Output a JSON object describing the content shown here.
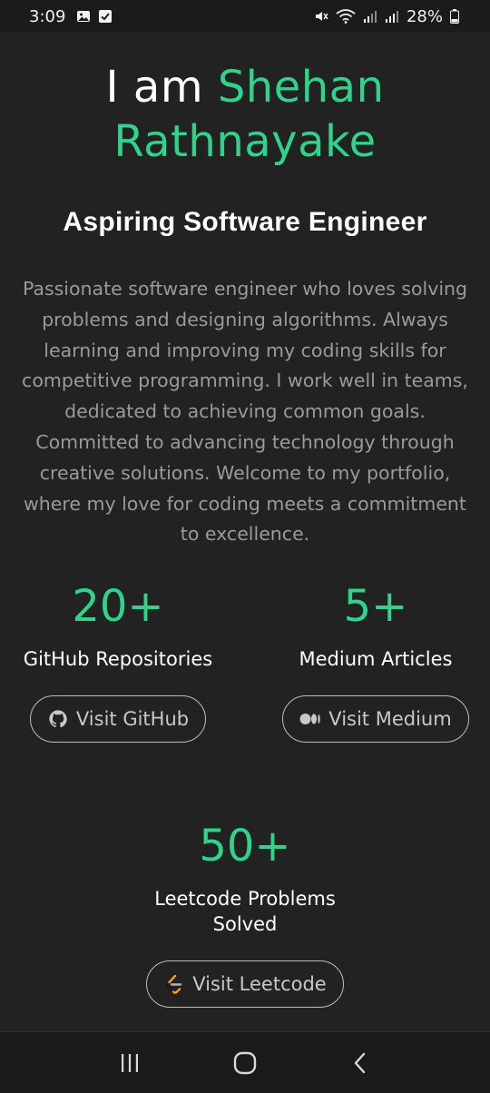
{
  "status_bar": {
    "time": "3:09",
    "battery": "28%",
    "left_icons": [
      "image-icon",
      "check-square-icon"
    ],
    "right_icons": [
      "mute-icon",
      "wifi-icon",
      "signal-icon",
      "signal-icon",
      "battery-icon"
    ]
  },
  "hero": {
    "prefix": "I am ",
    "name_line1": "Shehan",
    "name_line2": "Rathnayake",
    "role": "Aspiring Software Engineer",
    "bio": "Passionate software engineer who loves solving problems and designing algorithms. Always learning and improving my coding skills for competitive programming. I work well in teams, dedicated to achieving common goals. Committed to advancing technology through creative solutions. Welcome to my portfolio, where my love for coding meets a commitment to excellence."
  },
  "stats": {
    "github": {
      "value": "20+",
      "label": "GitHub Repositories",
      "button_label": "Visit GitHub",
      "icon": "github-icon"
    },
    "medium": {
      "value": "5+",
      "label": "Medium Articles",
      "button_label": "Visit Medium",
      "icon": "medium-icon"
    },
    "leetcode": {
      "value": "50+",
      "label": "Leetcode Problems Solved",
      "button_label": "Visit Leetcode",
      "icon": "leetcode-icon"
    }
  },
  "nav_bar": {
    "buttons": [
      "recent-apps-icon",
      "home-icon",
      "back-icon"
    ]
  },
  "colors": {
    "accent": "#2fd38a",
    "background": "#222222",
    "muted_text": "#9a9a9a"
  }
}
